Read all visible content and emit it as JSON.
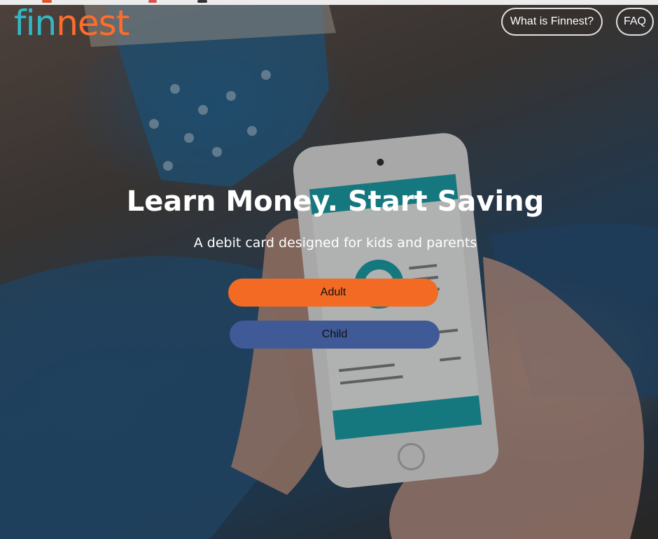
{
  "brand": {
    "logo_part1": "fin",
    "logo_part2": "nest",
    "colors": {
      "teal": "#33b8c7",
      "orange": "#ff6c2c"
    }
  },
  "nav": {
    "what_label": "What is Finnest?",
    "faq_label": "FAQ"
  },
  "hero": {
    "headline": "Learn Money. Start Saving",
    "subhead": "A debit card designed for kids and parents"
  },
  "actions": {
    "adult_label": "Adult",
    "adult_color": "#f26a24",
    "child_label": "Child",
    "child_color": "#3f5a96"
  }
}
